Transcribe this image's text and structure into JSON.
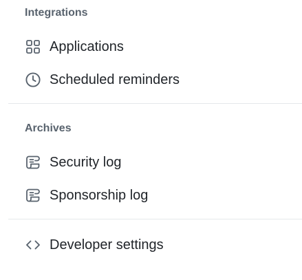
{
  "integrations": {
    "heading": "Integrations",
    "items": [
      {
        "label": "Applications",
        "icon": "apps-icon"
      },
      {
        "label": "Scheduled reminders",
        "icon": "clock-icon"
      }
    ]
  },
  "archives": {
    "heading": "Archives",
    "items": [
      {
        "label": "Security log",
        "icon": "log-icon"
      },
      {
        "label": "Sponsorship log",
        "icon": "log-icon"
      }
    ]
  },
  "developer": {
    "items": [
      {
        "label": "Developer settings",
        "icon": "code-icon"
      }
    ]
  },
  "colors": {
    "heading_text": "#59636e",
    "item_text": "#1f2328",
    "icon": "#59636e",
    "divider": "#e5e8eb"
  }
}
